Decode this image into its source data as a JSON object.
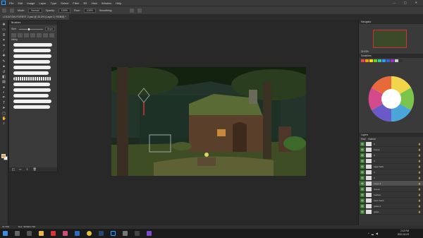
{
  "app": {
    "logo": "Ps"
  },
  "menu": [
    "File",
    "Edit",
    "Image",
    "Layer",
    "Type",
    "Select",
    "Filter",
    "3D",
    "View",
    "Window",
    "Help"
  ],
  "window_controls": [
    "—",
    "▢",
    "✕"
  ],
  "options": {
    "mode_label": "Mode:",
    "mode_value": "Normal",
    "opacity_label": "Opacity:",
    "opacity_value": "100%",
    "flow_label": "Flow:",
    "flow_value": "100%",
    "smoothing_label": "Smoothing:"
  },
  "document": {
    "tab_title": "LOCATION FOREST 2.psd @ 33.3% (Layer 2, RGB/8) *"
  },
  "brushes": {
    "title": "Brushes",
    "size_label": "Size:",
    "size_value": "44 px",
    "group_name": "Inking",
    "strokes": 12
  },
  "navigator": {
    "title": "Navigator",
    "zoom": "33.33%"
  },
  "swatches": {
    "title": "Swatches"
  },
  "layers": {
    "title": "Layers",
    "search": "Kind",
    "blend": "Normal",
    "rows": [
      {
        "name": "6",
        "selected": false
      },
      {
        "name": "house",
        "selected": false
      },
      {
        "name": "5",
        "selected": false
      },
      {
        "name": "4",
        "selected": false
      },
      {
        "name": "cage back",
        "selected": false
      },
      {
        "name": "3",
        "selected": false
      },
      {
        "name": "2",
        "selected": false
      },
      {
        "name": "Layer 2",
        "selected": true
      },
      {
        "name": "cutout",
        "selected": false
      },
      {
        "name": "bushes",
        "selected": false
      },
      {
        "name": "trees back",
        "selected": false
      },
      {
        "name": "grass 2",
        "selected": false
      },
      {
        "name": "grass",
        "selected": false
      }
    ]
  },
  "status": {
    "zoom": "33.33%",
    "doc": "Doc: 48.5M/1.73G"
  },
  "taskbar": {
    "time": "2:13 PM",
    "date": "2022-02-03"
  },
  "colors": {
    "fg": "#e8a23a",
    "bg": "#ffffff",
    "accent": "#31a8ff"
  },
  "tools": [
    "move-icon",
    "marquee-icon",
    "lasso-icon",
    "wand-icon",
    "crop-icon",
    "eyedropper-icon",
    "healing-icon",
    "brush-icon",
    "stamp-icon",
    "history-brush-icon",
    "eraser-icon",
    "gradient-icon",
    "blur-icon",
    "dodge-icon",
    "pen-icon",
    "type-icon",
    "path-select-icon",
    "shape-icon",
    "hand-icon",
    "zoom-icon"
  ]
}
